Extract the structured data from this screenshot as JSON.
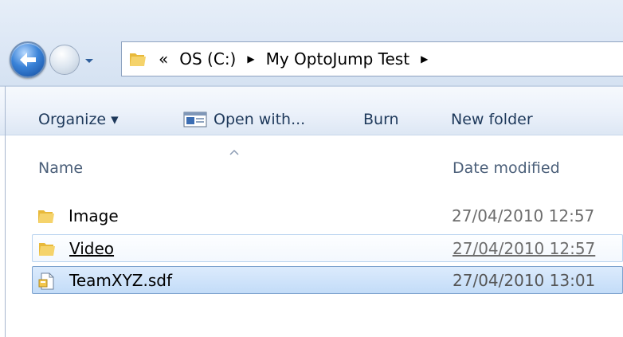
{
  "address": {
    "overflow_glyph": "«",
    "segments": [
      "OS (C:)",
      "My OptoJump Test"
    ],
    "separator_glyph": "▶"
  },
  "toolbar": {
    "organize_label": "Organize ▾",
    "open_with_label": "Open with...",
    "burn_label": "Burn",
    "new_folder_label": "New folder"
  },
  "columns": {
    "name": "Name",
    "date_modified": "Date modified"
  },
  "files": [
    {
      "name": "Image",
      "date": "27/04/2010 12:57",
      "type": "folder"
    },
    {
      "name": "Video",
      "date": "27/04/2010 12:57",
      "type": "folder",
      "state": "hover"
    },
    {
      "name": "TeamXYZ.sdf",
      "date": "27/04/2010 13:01",
      "type": "file",
      "state": "selected"
    }
  ],
  "colors": {
    "folder": "#e8b93a",
    "selection": "#c3dcf8",
    "hover_border": "#b9d3ef"
  }
}
